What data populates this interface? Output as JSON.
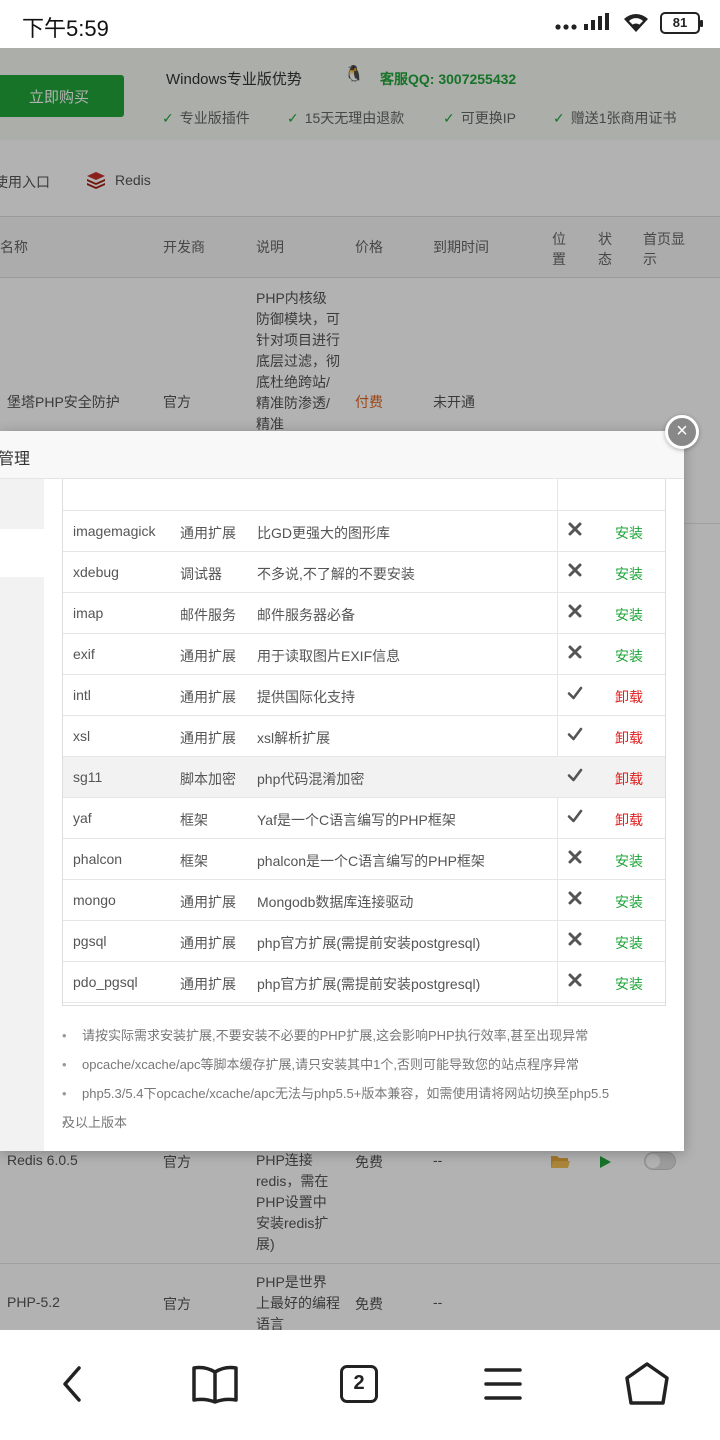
{
  "status_bar": {
    "time": "下午5:59",
    "signal": "....",
    "battery": "81"
  },
  "promo": {
    "buy_label": "立即购买",
    "title": "Windows专业版优势",
    "qq_label": "客服QQ: 3007255432",
    "features": [
      "专业版插件",
      "15天无理由退款",
      "可更换IP",
      "赠送1张商用证书"
    ]
  },
  "tabs": [
    "使用入口",
    "Redis"
  ],
  "table": {
    "headers": [
      "名称",
      "开发商",
      "说明",
      "价格",
      "到期时间",
      "位置",
      "状态",
      "首页显示"
    ],
    "rows": [
      {
        "name": "堡塔PHP安全防护",
        "vendor": "官方",
        "desc": "PHP内核级防御模块，可针对项目进行底层过滤，彻底杜绝跨站/精准防渗透/精准",
        "price": "付费",
        "expiry": "未开通"
      },
      {
        "name": "Redis 6.0.5",
        "vendor": "官方",
        "desc": "PHP连接redis，需在PHP设置中安装redis扩展)",
        "price": "免费",
        "expiry": "--"
      },
      {
        "name": "PHP-5.2",
        "vendor": "官方",
        "desc": "PHP是世界上最好的编程语言",
        "price": "免费",
        "expiry": "--"
      }
    ]
  },
  "modal": {
    "title": "管理",
    "close_label": "×",
    "extensions": [
      {
        "name": "imagemagick",
        "type": "通用扩展",
        "desc": "比GD更强大的图形库",
        "installed": false,
        "action": "安装"
      },
      {
        "name": "xdebug",
        "type": "调试器",
        "desc": "不多说,不了解的不要安装",
        "installed": false,
        "action": "安装"
      },
      {
        "name": "imap",
        "type": "邮件服务",
        "desc": "邮件服务器必备",
        "installed": false,
        "action": "安装"
      },
      {
        "name": "exif",
        "type": "通用扩展",
        "desc": "用于读取图片EXIF信息",
        "installed": false,
        "action": "安装"
      },
      {
        "name": "intl",
        "type": "通用扩展",
        "desc": "提供国际化支持",
        "installed": true,
        "action": "卸载"
      },
      {
        "name": "xsl",
        "type": "通用扩展",
        "desc": "xsl解析扩展",
        "installed": true,
        "action": "卸载"
      },
      {
        "name": "sg11",
        "type": "脚本加密",
        "desc": "php代码混淆加密",
        "installed": true,
        "action": "卸载"
      },
      {
        "name": "yaf",
        "type": "框架",
        "desc": "Yaf是一个C语言编写的PHP框架",
        "installed": true,
        "action": "卸载"
      },
      {
        "name": "phalcon",
        "type": "框架",
        "desc": "phalcon是一个C语言编写的PHP框架",
        "installed": false,
        "action": "安装"
      },
      {
        "name": "mongo",
        "type": "通用扩展",
        "desc": "Mongodb数据库连接驱动",
        "installed": false,
        "action": "安装"
      },
      {
        "name": "pgsql",
        "type": "通用扩展",
        "desc": "php官方扩展(需提前安装postgresql)",
        "installed": false,
        "action": "安装"
      },
      {
        "name": "pdo_pgsql",
        "type": "通用扩展",
        "desc": "php官方扩展(需提前安装postgresql)",
        "installed": false,
        "action": "安装"
      }
    ],
    "notes": [
      "请按实际需求安装扩展,不要安装不必要的PHP扩展,这会影响PHP执行效率,甚至出现异常",
      "opcache/xcache/apc等脚本缓存扩展,请只安装其中1个,否则可能导致您的站点程序异常",
      "php5.3/5.4下opcache/xcache/apc无法与php5.5+版本兼容，如需使用请将网站切换至php5.5",
      "及以上版本"
    ]
  },
  "bottom_nav": {
    "tabs_count": "2"
  },
  "colors": {
    "green": "#20a53a",
    "red": "#e02020",
    "orange": "#e06420"
  }
}
